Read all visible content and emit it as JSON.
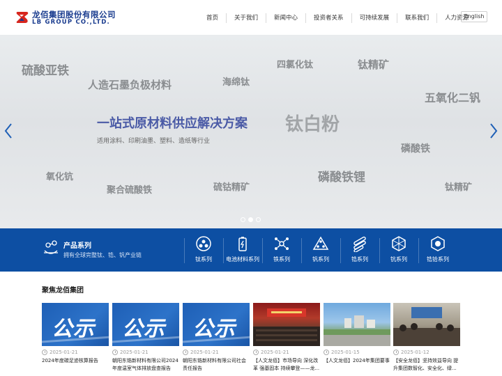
{
  "brand": {
    "name_cn": "龙佰集团股份有限公司",
    "name_en": "LB GROUP CO.,LTD."
  },
  "nav": {
    "items": [
      "首页",
      "关于我们",
      "新闻中心",
      "投资者关系",
      "可持续发展",
      "联系我们",
      "人力资源"
    ],
    "language_button": "English"
  },
  "banner": {
    "headline": "一站式原材料供应解决方案",
    "subline": "适用涂料、印刷油墨、塑料、造纸等行业",
    "words": [
      "硫酸亚铁",
      "人造石墨负极材料",
      "海绵钛",
      "四氯化钛",
      "钛精矿",
      "五氧化二钒",
      "钛白粉",
      "磷酸铁",
      "氧化钪",
      "聚合硫酸铁",
      "硫钴精矿",
      "磷酸铁锂",
      "钛精矿"
    ],
    "slide_count": 3,
    "active_slide": 2
  },
  "products": {
    "title": "产品系列",
    "subtitle": "拥有全球完整钛、锆、钒产业链",
    "categories": [
      "钛系列",
      "电池材料系列",
      "铁系列",
      "钒系列",
      "锆系列",
      "钪系列",
      "锆铪系列"
    ]
  },
  "focus": {
    "title": "聚焦龙佰集团",
    "thumb_text": "公示",
    "news": [
      {
        "date": "2025-01-21",
        "title": "2024年度碳足迹核算报告"
      },
      {
        "date": "2025-01-21",
        "title": "朝阳东锆新材料有限公司2024年度温室气体排放盘查报告"
      },
      {
        "date": "2025-01-21",
        "title": "朝阳东锆新材料有限公司社会责任报告"
      },
      {
        "date": "2025-01-21",
        "title": "【人文龙佰】市场导向 深化改革 强基固本 持续攀登——龙..."
      },
      {
        "date": "2025-01-15",
        "title": "【人文龙佰】2024年集团要事"
      },
      {
        "date": "2025-01-12",
        "title": "【安全龙佰】坚持效益导向 提升集团数智化、安全化、绿..."
      }
    ]
  },
  "colors": {
    "brand_blue": "#0d4fa3",
    "headline": "#4a5aa6",
    "logo_red": "#d7261e"
  }
}
